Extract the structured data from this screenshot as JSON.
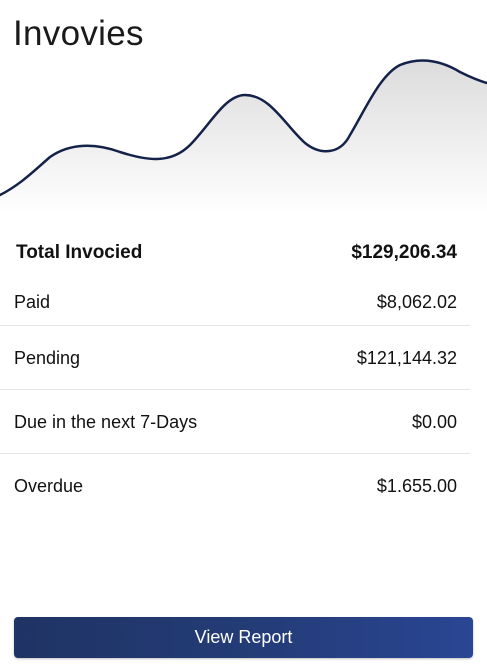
{
  "card": {
    "title": "Invovies"
  },
  "chart": {
    "line_color": "#14224a",
    "fill_top": "#e2e2e2",
    "fill_bottom": "#ffffff"
  },
  "summary": {
    "total": {
      "label": "Total Invocied",
      "value": "$129,206.34"
    },
    "rows": [
      {
        "label": "Paid",
        "value": "$8,062.02"
      },
      {
        "label": "Pending",
        "value": "$121,144.32"
      },
      {
        "label": "Due in the next 7-Days",
        "value": "$0.00"
      },
      {
        "label": "Overdue",
        "value": "$1.655.00"
      }
    ]
  },
  "actions": {
    "view_report_label": "View Report",
    "button_color": "#243c78"
  }
}
